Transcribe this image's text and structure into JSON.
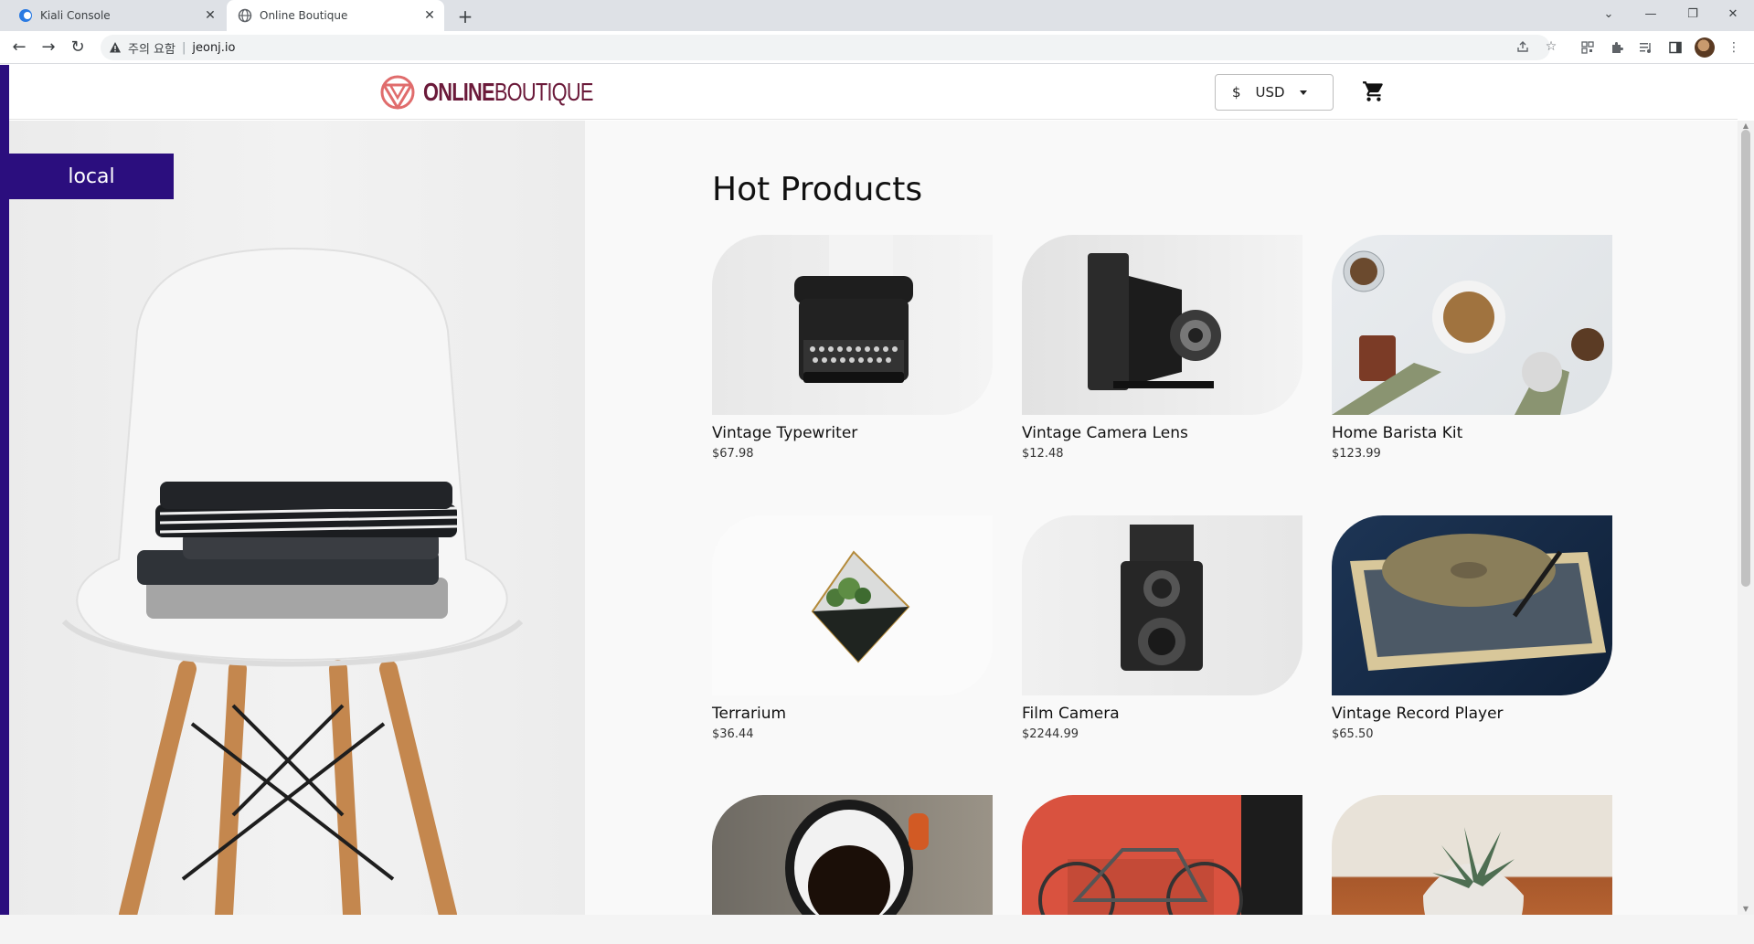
{
  "browser": {
    "tabs": [
      {
        "title": "Kiali Console",
        "active": false
      },
      {
        "title": "Online Boutique",
        "active": true
      }
    ],
    "address": {
      "security_label": "주의 요함",
      "url": "jeonj.io"
    }
  },
  "site": {
    "brand_bold": "ONLINE",
    "brand_light": "BOUTIQUE",
    "currency_symbol": "$",
    "currency_code": "USD",
    "cluster_label": "local"
  },
  "products": {
    "title": "Hot Products",
    "items": [
      {
        "name": "Vintage Typewriter",
        "price": "$67.98"
      },
      {
        "name": "Vintage Camera Lens",
        "price": "$12.48"
      },
      {
        "name": "Home Barista Kit",
        "price": "$123.99"
      },
      {
        "name": "Terrarium",
        "price": "$36.44"
      },
      {
        "name": "Film Camera",
        "price": "$2244.99"
      },
      {
        "name": "Vintage Record Player",
        "price": "$65.50"
      }
    ]
  },
  "colors": {
    "accent": "#2b0e7e",
    "brand": "#6b1a3a",
    "logo_mark": "#e06c6c"
  },
  "icons": [
    "back-arrow-icon",
    "forward-arrow-icon",
    "reload-icon",
    "warning-icon",
    "share-icon",
    "star-icon",
    "qr-icon",
    "extensions-icon",
    "media-icon",
    "sidepanel-icon",
    "cart-icon",
    "chevron-down-icon"
  ]
}
